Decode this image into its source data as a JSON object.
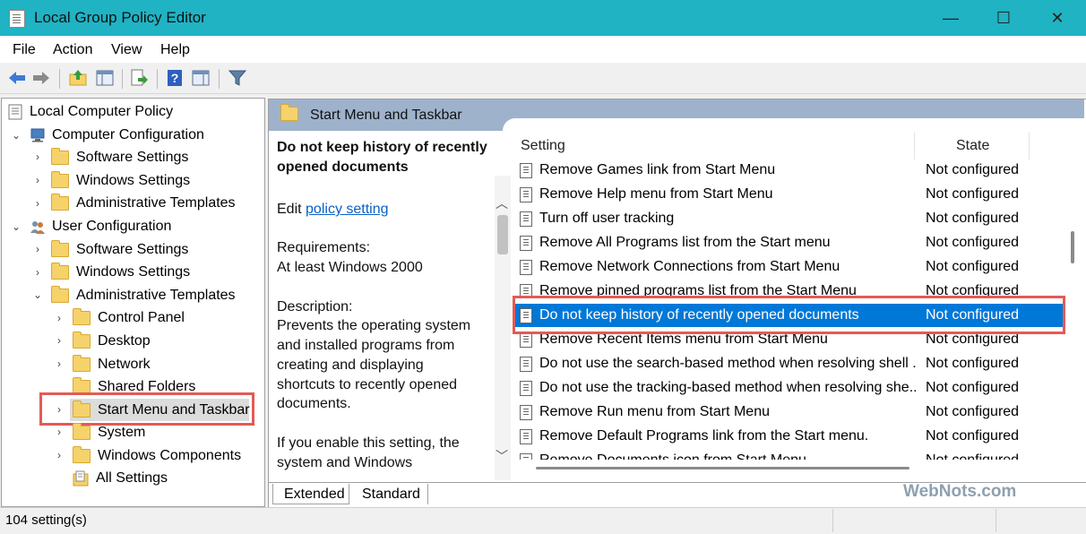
{
  "window": {
    "title": "Local Group Policy Editor",
    "minimize": "—",
    "maximize": "☐",
    "close": "✕"
  },
  "menu": [
    "File",
    "Action",
    "View",
    "Help"
  ],
  "tree": {
    "root": "Local Computer Policy",
    "computer_config": "Computer Configuration",
    "cc_software": "Software Settings",
    "cc_windows": "Windows Settings",
    "cc_admin": "Administrative Templates",
    "user_config": "User Configuration",
    "uc_software": "Software Settings",
    "uc_windows": "Windows Settings",
    "uc_admin": "Administrative Templates",
    "control_panel": "Control Panel",
    "desktop": "Desktop",
    "network": "Network",
    "shared_folders": "Shared Folders",
    "start_menu": "Start Menu and Taskbar",
    "system": "System",
    "windows_components": "Windows Components",
    "all_settings": "All Settings"
  },
  "panel": {
    "header": "Start Menu and Taskbar",
    "policy_title_1": "Do not keep history of recently",
    "policy_title_2": "opened documents",
    "edit_prefix": "Edit",
    "edit_link": "policy setting",
    "requirements_label": "Requirements:",
    "requirements_value": "At least Windows 2000",
    "description_label": "Description:",
    "desc_1": "Prevents the operating system",
    "desc_2": "and installed programs from",
    "desc_3": "creating and displaying",
    "desc_4": "shortcuts to recently opened",
    "desc_5": "documents.",
    "desc_6": "If you enable this setting, the",
    "desc_7": "system and Windows"
  },
  "list": {
    "col_setting": "Setting",
    "col_state": "State",
    "rows": [
      {
        "name": "Remove Games link from Start Menu",
        "state": "Not configured"
      },
      {
        "name": "Remove Help menu from Start Menu",
        "state": "Not configured"
      },
      {
        "name": "Turn off user tracking",
        "state": "Not configured"
      },
      {
        "name": "Remove All Programs list from the Start menu",
        "state": "Not configured"
      },
      {
        "name": "Remove Network Connections from Start Menu",
        "state": "Not configured"
      },
      {
        "name": "Remove pinned programs list from the Start Menu",
        "state": "Not configured"
      },
      {
        "name": "Do not keep history of recently opened documents",
        "state": "Not configured"
      },
      {
        "name": "Remove Recent Items menu from Start Menu",
        "state": "Not configured"
      },
      {
        "name": "Do not use the search-based method when resolving shell ...",
        "state": "Not configured"
      },
      {
        "name": "Do not use the tracking-based method when resolving she...",
        "state": "Not configured"
      },
      {
        "name": "Remove Run menu from Start Menu",
        "state": "Not configured"
      },
      {
        "name": "Remove Default Programs link from the Start menu.",
        "state": "Not configured"
      },
      {
        "name": "Remove Documents icon from Start Menu",
        "state": "Not configured"
      }
    ]
  },
  "tabs": {
    "extended": "Extended",
    "standard": "Standard"
  },
  "status": {
    "text": "104 setting(s)"
  },
  "watermark": "WebNots.com",
  "colors": {
    "titlebar": "#1fb3c4",
    "selection": "#0078d7",
    "highlight_box": "#e25b55",
    "panel_header": "#9eb2cc"
  }
}
